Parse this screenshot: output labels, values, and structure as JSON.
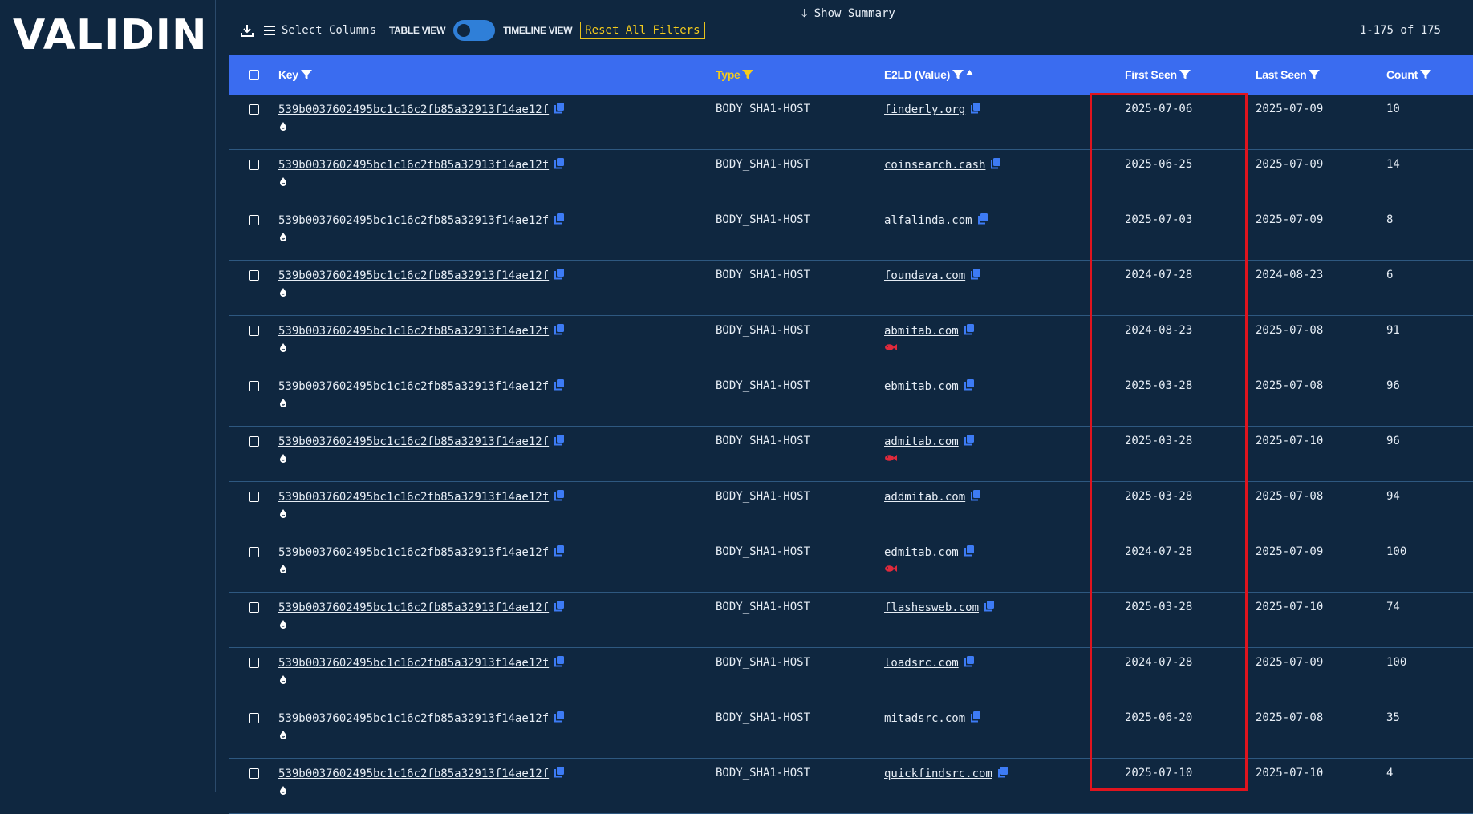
{
  "app": {
    "logo_text": "VALIDIN"
  },
  "summary_toggle": {
    "label": "Show Summary",
    "icon": "arrow-down-icon"
  },
  "toolbar": {
    "select_columns_label": "Select Columns",
    "table_view_label": "TABLE VIEW",
    "timeline_view_label": "TIMELINE VIEW",
    "reset_filters_label": "Reset All Filters",
    "page_count": "1-175 of 175"
  },
  "table": {
    "columns": {
      "key": "Key",
      "type": "Type",
      "value": "E2LD (Value)",
      "first_seen": "First Seen",
      "last_seen": "Last Seen",
      "count": "Count"
    },
    "rows": [
      {
        "key": "539b0037602495bc1c16c2fb85a32913f14ae12f",
        "type": "BODY_SHA1-HOST",
        "value": "finderly.org",
        "first": "2025-07-06",
        "last": "2025-07-09",
        "count": "10",
        "flag": false
      },
      {
        "key": "539b0037602495bc1c16c2fb85a32913f14ae12f",
        "type": "BODY_SHA1-HOST",
        "value": "coinsearch.cash",
        "first": "2025-06-25",
        "last": "2025-07-09",
        "count": "14",
        "flag": false
      },
      {
        "key": "539b0037602495bc1c16c2fb85a32913f14ae12f",
        "type": "BODY_SHA1-HOST",
        "value": "alfalinda.com",
        "first": "2025-07-03",
        "last": "2025-07-09",
        "count": "8",
        "flag": false
      },
      {
        "key": "539b0037602495bc1c16c2fb85a32913f14ae12f",
        "type": "BODY_SHA1-HOST",
        "value": "foundava.com",
        "first": "2024-07-28",
        "last": "2024-08-23",
        "count": "6",
        "flag": false
      },
      {
        "key": "539b0037602495bc1c16c2fb85a32913f14ae12f",
        "type": "BODY_SHA1-HOST",
        "value": "abmitab.com",
        "first": "2024-08-23",
        "last": "2025-07-08",
        "count": "91",
        "flag": true
      },
      {
        "key": "539b0037602495bc1c16c2fb85a32913f14ae12f",
        "type": "BODY_SHA1-HOST",
        "value": "ebmitab.com",
        "first": "2025-03-28",
        "last": "2025-07-08",
        "count": "96",
        "flag": false
      },
      {
        "key": "539b0037602495bc1c16c2fb85a32913f14ae12f",
        "type": "BODY_SHA1-HOST",
        "value": "admitab.com",
        "first": "2025-03-28",
        "last": "2025-07-10",
        "count": "96",
        "flag": true
      },
      {
        "key": "539b0037602495bc1c16c2fb85a32913f14ae12f",
        "type": "BODY_SHA1-HOST",
        "value": "addmitab.com",
        "first": "2025-03-28",
        "last": "2025-07-08",
        "count": "94",
        "flag": false
      },
      {
        "key": "539b0037602495bc1c16c2fb85a32913f14ae12f",
        "type": "BODY_SHA1-HOST",
        "value": "edmitab.com",
        "first": "2024-07-28",
        "last": "2025-07-09",
        "count": "100",
        "flag": true
      },
      {
        "key": "539b0037602495bc1c16c2fb85a32913f14ae12f",
        "type": "BODY_SHA1-HOST",
        "value": "flashesweb.com",
        "first": "2025-03-28",
        "last": "2025-07-10",
        "count": "74",
        "flag": false
      },
      {
        "key": "539b0037602495bc1c16c2fb85a32913f14ae12f",
        "type": "BODY_SHA1-HOST",
        "value": "loadsrc.com",
        "first": "2024-07-28",
        "last": "2025-07-09",
        "count": "100",
        "flag": false
      },
      {
        "key": "539b0037602495bc1c16c2fb85a32913f14ae12f",
        "type": "BODY_SHA1-HOST",
        "value": "mitadsrc.com",
        "first": "2025-06-20",
        "last": "2025-07-08",
        "count": "35",
        "flag": false
      },
      {
        "key": "539b0037602495bc1c16c2fb85a32913f14ae12f",
        "type": "BODY_SHA1-HOST",
        "value": "quickfindsrc.com",
        "first": "2025-07-10",
        "last": "2025-07-10",
        "count": "4",
        "flag": false
      }
    ]
  },
  "colors": {
    "background": "#0f2740",
    "header": "#3a6cf0",
    "accent_yellow": "#f5cc1c",
    "highlight_red": "#e0141e",
    "flag_red": "#e02a3c"
  }
}
